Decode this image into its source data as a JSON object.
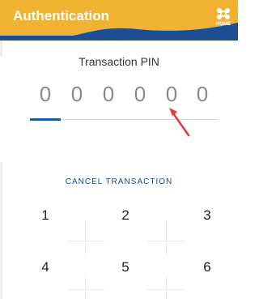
{
  "header": {
    "title": "Authentication",
    "home_label": "HOME",
    "colors": {
      "yellow": "#f2b231",
      "blue": "#1c4f94",
      "accent": "#1a5aa0"
    }
  },
  "pin": {
    "title": "Transaction PIN",
    "digits": [
      "0",
      "0",
      "0",
      "0",
      "0",
      "0"
    ],
    "active_index": 0
  },
  "cancel_label": "CANCEL TRANSACTION",
  "keypad": {
    "keys": [
      "1",
      "2",
      "3",
      "4",
      "5",
      "6"
    ]
  },
  "annotation": {
    "icon": "red-arrow-icon",
    "color": "#e53935"
  }
}
